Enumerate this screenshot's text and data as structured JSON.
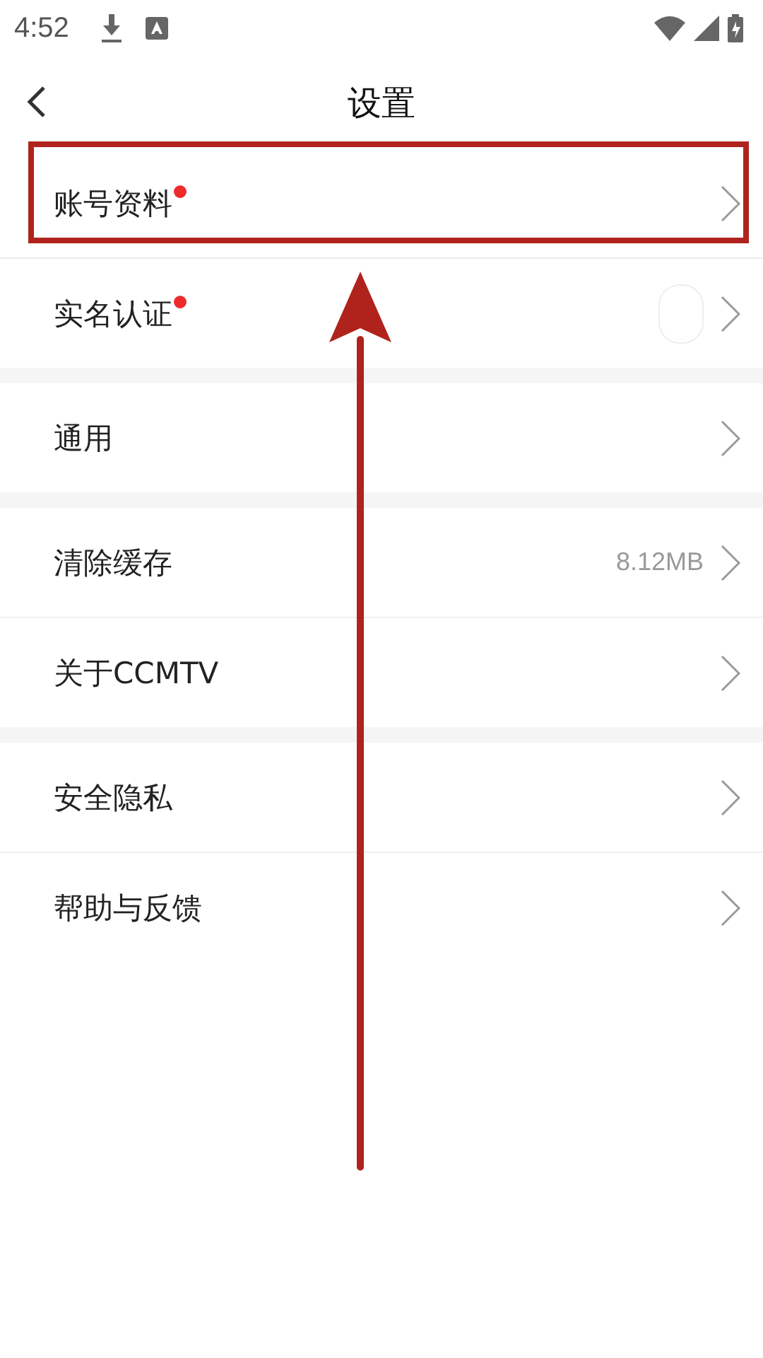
{
  "status_bar": {
    "time": "4:52"
  },
  "header": {
    "title": "设置"
  },
  "sections": [
    {
      "items": [
        {
          "label": "账号资料",
          "dot": true,
          "highlighted": true
        },
        {
          "label": "实名认证",
          "dot": true,
          "highlighted": false,
          "thumbnail": true
        }
      ]
    },
    {
      "items": [
        {
          "label": "通用",
          "dot": false,
          "highlighted": false
        }
      ]
    },
    {
      "items": [
        {
          "label": "清除缓存",
          "dot": false,
          "highlighted": false,
          "value": "8.12MB"
        },
        {
          "label": "关于CCMTV",
          "dot": false,
          "highlighted": false
        }
      ]
    },
    {
      "items": [
        {
          "label": "安全隐私",
          "dot": false,
          "highlighted": false
        },
        {
          "label": "帮助与反馈",
          "dot": false,
          "highlighted": false
        }
      ]
    }
  ],
  "annotation": {
    "kind": "arrow"
  }
}
